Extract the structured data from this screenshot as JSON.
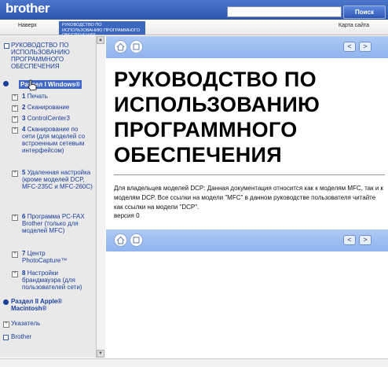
{
  "header": {
    "logo": "brother",
    "search_placeholder": "",
    "search_button": "Поиск"
  },
  "nav": {
    "back": "Наверх",
    "tab": "РУКОВОДСТВО ПО ИСПОЛЬЗОВАНИЮ ПРОГРАММНОГО ОБЕСПЕЧЕНИЯ",
    "sitemap": "Карта сайта"
  },
  "sidebar": {
    "home": "РУКОВОДСТВО ПО ИСПОЛЬЗОВАНИЮ ПРОГРАММНОГО ОБЕСПЕЧЕНИЯ",
    "section1": "Раздел I Windows®",
    "items": [
      {
        "num": "1",
        "label": "Печать"
      },
      {
        "num": "2",
        "label": "Сканирование"
      },
      {
        "num": "3",
        "label": "ControlCenter3"
      },
      {
        "num": "4",
        "label": "Сканирование по сети (для моделей со встроенным сетевым интерфейсом)"
      },
      {
        "num": "5",
        "label": "Удаленная настройка (кроме моделей DCP, MFC-235C и MFC-260C)"
      },
      {
        "num": "6",
        "label": "Программа PC-FAX Brother (только для моделей MFC)"
      },
      {
        "num": "7",
        "label": "Центр PhotoCapture™"
      },
      {
        "num": "8",
        "label": "Настройки брандмауэра (для пользователей сети)"
      }
    ],
    "section2": "Раздел II Apple® Macintosh®",
    "index": "Указатель",
    "brother": "Brother"
  },
  "content": {
    "title": "РУКОВОДСТВО ПО ИСПОЛЬЗОВАНИЮ ПРОГРАММНОГО ОБЕСПЕЧЕНИЯ",
    "description": "Для владельцев моделей DCP: Данная документация относится как к моделям MFC, так и к моделям DCP. Все ссылки на модели \"MFC\" в данном руководстве пользователя читайте как ссылки на модели \"DCP\".",
    "version": "версия 0"
  },
  "colors": {
    "header_blue": "#2e56ad",
    "toolbar_blue": "#9dbdf1",
    "link_blue": "#1b3e9c"
  }
}
